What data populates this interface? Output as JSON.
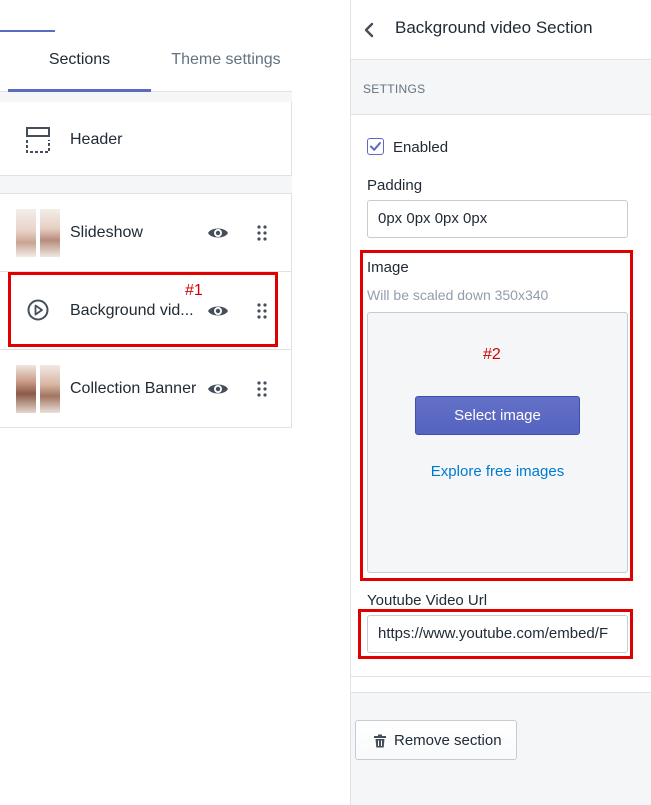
{
  "left_panel": {
    "tabs": [
      {
        "label": "Sections",
        "active": true
      },
      {
        "label": "Theme settings",
        "active": false
      }
    ],
    "header_item": {
      "label": "Header",
      "icon": "header-layout-icon"
    },
    "sections": [
      {
        "label": "Slideshow",
        "thumb": "slideshow-thumbnail"
      },
      {
        "label": "Background vid...",
        "icon": "play-circle-icon"
      },
      {
        "label": "Collection Banner",
        "thumb": "collection-banner-thumbnail"
      }
    ]
  },
  "right_panel": {
    "title": "Background video Section",
    "settings_heading": "SETTINGS",
    "enabled": {
      "label": "Enabled",
      "checked": true
    },
    "padding": {
      "label": "Padding",
      "value": "0px 0px 0px 0px"
    },
    "image": {
      "label": "Image",
      "hint": "Will be scaled down 350x340",
      "select_button": "Select image",
      "explore_link": "Explore free images"
    },
    "youtube": {
      "label": "Youtube Video Url",
      "value": "https://www.youtube.com/embed/F"
    },
    "remove_button": "Remove section"
  },
  "annotations": {
    "tag1": "#1",
    "tag2": "#2"
  },
  "colors": {
    "accent": "#5c6ac4",
    "annotation": "#e00000",
    "link": "#007ace"
  }
}
